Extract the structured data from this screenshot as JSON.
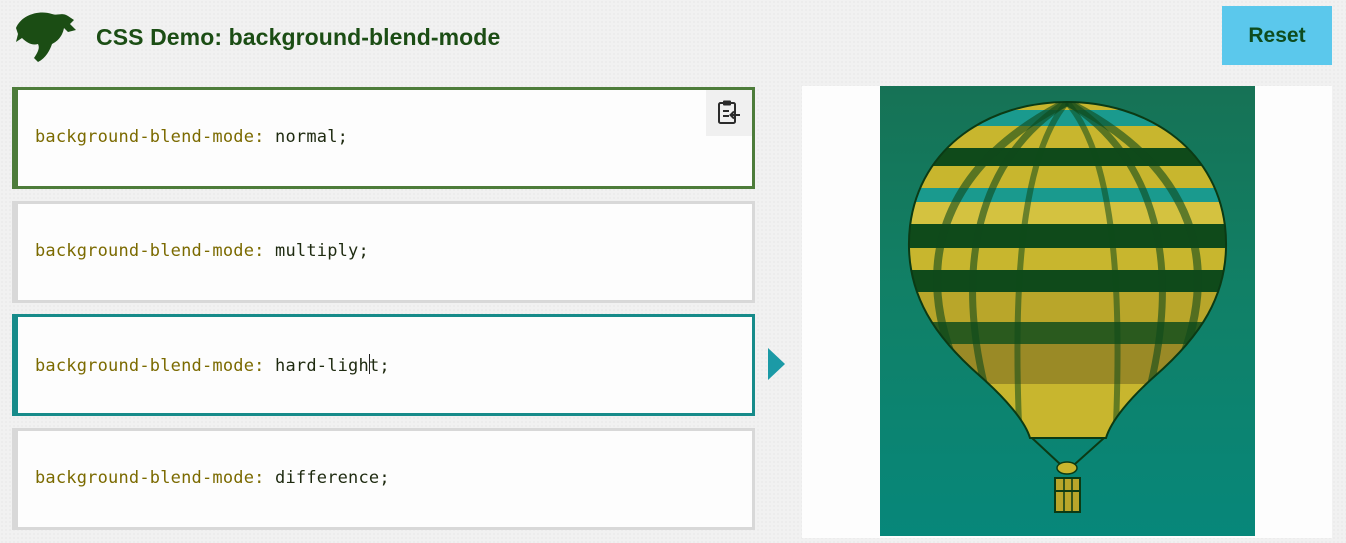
{
  "header": {
    "title": "CSS Demo: background-blend-mode",
    "reset_label": "Reset",
    "logo_icon": "dino-logo-icon",
    "title_color": "#1b4d14",
    "reset_bg": "#5bc8ec"
  },
  "options": [
    {
      "property": "background-blend-mode:",
      "value": "normal",
      "terminator": ";",
      "state": "selected"
    },
    {
      "property": "background-blend-mode:",
      "value": "multiply",
      "terminator": ";",
      "state": "default"
    },
    {
      "property": "background-blend-mode:",
      "value_before_caret": "hard-ligh",
      "value_after_caret": "t",
      "terminator": ";",
      "state": "active"
    },
    {
      "property": "background-blend-mode:",
      "value": "difference",
      "terminator": ";",
      "state": "default"
    }
  ],
  "copy_button_icon": "clipboard-copy-icon",
  "arrow_icon": "play-arrow-icon",
  "output": {
    "image": "hot-air-balloon-image",
    "colors": {
      "sky": "#118066",
      "stripe_yellow": "#c8b62e",
      "stripe_dark": "#0f4a1a",
      "stripe_teal": "#1a9a8e"
    }
  },
  "accents": {
    "selected_border": "#4d7c3a",
    "active_border": "#178b8a",
    "property_color": "#7b6a00"
  }
}
